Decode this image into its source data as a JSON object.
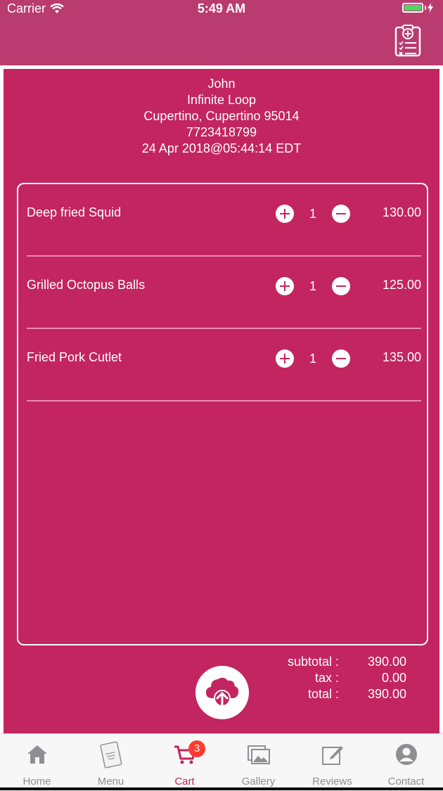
{
  "status_bar": {
    "carrier": "Carrier",
    "time": "5:49 AM"
  },
  "customer": {
    "name": "John",
    "street": "Infinite Loop",
    "city": "Cupertino, Cupertino 95014",
    "phone": "7723418799",
    "datetime": "24 Apr 2018@05:44:14 EDT"
  },
  "items": [
    {
      "name": "Deep fried Squid",
      "qty": "1",
      "price": "130.00"
    },
    {
      "name": "Grilled Octopus Balls",
      "qty": "1",
      "price": "125.00"
    },
    {
      "name": "Fried Pork Cutlet",
      "qty": "1",
      "price": "135.00"
    }
  ],
  "totals": {
    "subtotal_label": "subtotal :",
    "subtotal": "390.00",
    "tax_label": "tax :",
    "tax": "0.00",
    "total_label": "total :",
    "total": "390.00"
  },
  "tabs": [
    {
      "label": "Home",
      "icon": "home-icon"
    },
    {
      "label": "Menu",
      "icon": "menu-book-icon"
    },
    {
      "label": "Cart",
      "icon": "cart-icon",
      "badge": "3",
      "active": true
    },
    {
      "label": "Gallery",
      "icon": "gallery-icon"
    },
    {
      "label": "Reviews",
      "icon": "reviews-icon"
    },
    {
      "label": "Contact",
      "icon": "contact-icon"
    }
  ],
  "colors": {
    "brand": "#c2255f",
    "topbar": "#ba3b6f",
    "badge": "#ff3b30"
  }
}
